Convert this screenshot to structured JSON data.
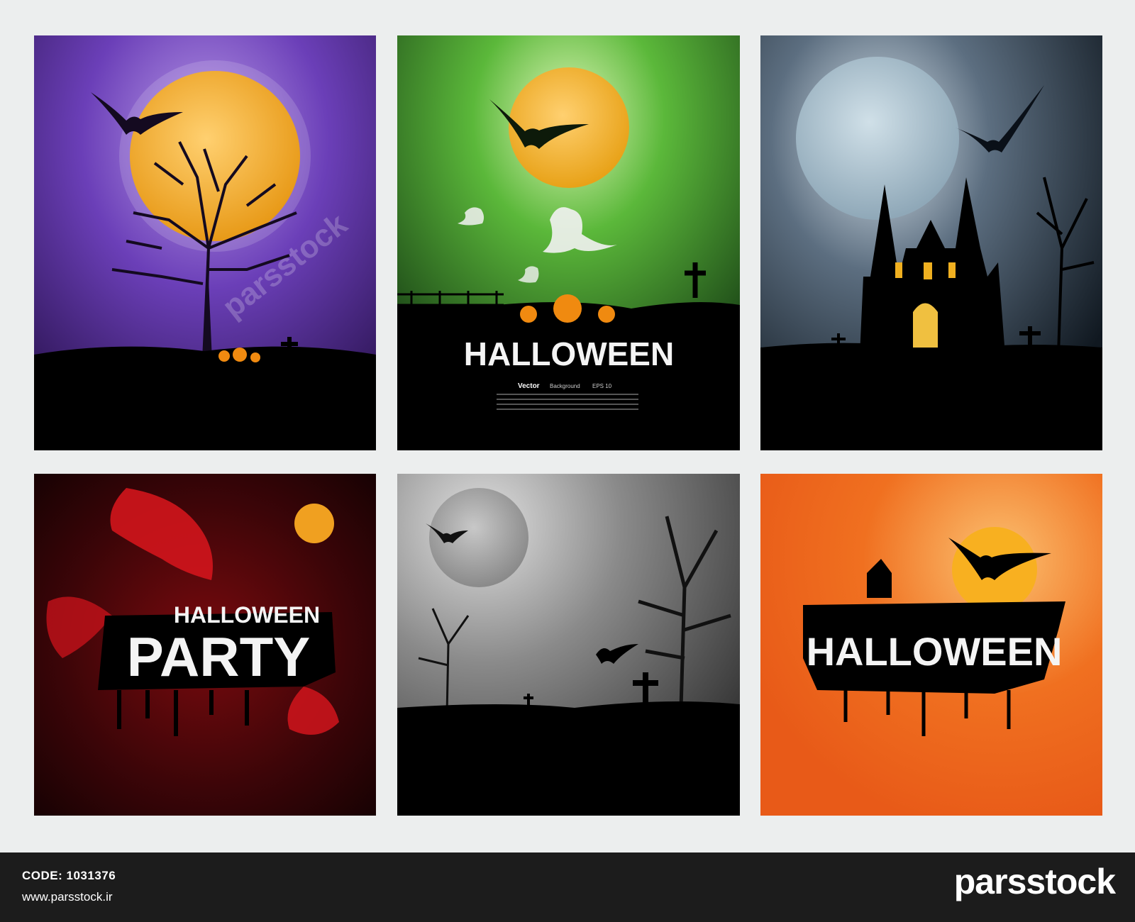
{
  "panels": [
    {
      "id": "purple-moon-tree",
      "accent": "#f0a020",
      "bg": "#6b3fb8"
    },
    {
      "id": "green-ghosts",
      "accent": "#f2c02a",
      "bg": "#3a9b2a",
      "title": "HALLOWEEN",
      "caption": "Vector",
      "caption_sub": "Background",
      "caption_eps": "EPS 10"
    },
    {
      "id": "blue-castle",
      "accent": "#b7c8d4",
      "bg": "#5c6e80"
    },
    {
      "id": "red-party",
      "accent": "#e81c1c",
      "bg": "#b3121a",
      "title_small": "HALLOWEEN",
      "title_big": "PARTY"
    },
    {
      "id": "gray-graveyard",
      "accent": "#9a9a9a",
      "bg": "#7a7a7a"
    },
    {
      "id": "orange-halloween",
      "accent": "#f0a020",
      "bg": "#f07020",
      "title": "HALLOWEEN"
    }
  ],
  "watermark": "parsstock",
  "footer": {
    "code_label": "CODE: 1031376",
    "url": "www.parsstock.ir",
    "brand": "parsstock"
  }
}
